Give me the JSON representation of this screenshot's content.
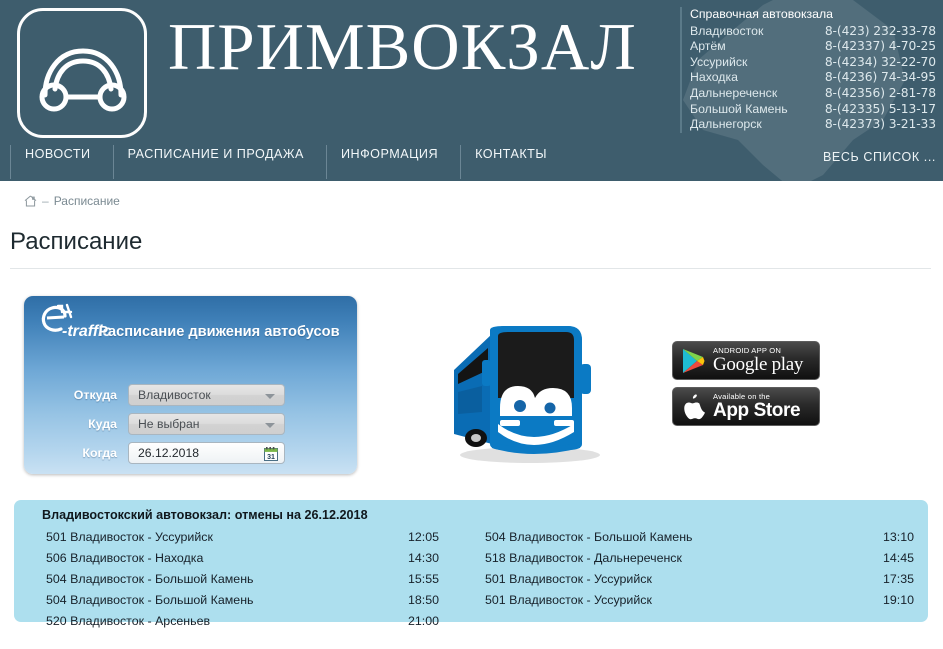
{
  "header": {
    "brand": "ПРИМВОКЗАЛ",
    "logo_icon": "bus-front-icon",
    "map_icon": "region-map-silhouette",
    "nav": [
      {
        "label": "НОВОСТИ",
        "name": "nav-news"
      },
      {
        "label": "РАСПИСАНИЕ И ПРОДАЖА",
        "name": "nav-schedule-sales"
      },
      {
        "label": "ИНФОРМАЦИЯ",
        "name": "nav-information"
      },
      {
        "label": "КОНТАКТЫ",
        "name": "nav-contacts"
      }
    ],
    "info": {
      "title": "Справочная автовокзала",
      "rows": [
        {
          "city": "Владивосток",
          "phone": "8-(423) 232-33-78"
        },
        {
          "city": "Артём",
          "phone": "8-(42337) 4-70-25"
        },
        {
          "city": "Уссурийск",
          "phone": "8-(4234) 32-22-70"
        },
        {
          "city": "Находка",
          "phone": "8-(4236) 74-34-95"
        },
        {
          "city": "Дальнереченск",
          "phone": "8-(42356) 2-81-78"
        },
        {
          "city": "Большой Камень",
          "phone": "8-(42335) 5-13-17"
        },
        {
          "city": "Дальнегорск",
          "phone": "8-(42373) 3-21-33"
        }
      ],
      "all_list_label": "ВЕСЬ СПИСОК ..."
    }
  },
  "breadcrumb": {
    "home_icon": "home-icon",
    "separator": "–",
    "current": "Расписание"
  },
  "page": {
    "title": "Расписание"
  },
  "search_form": {
    "logo_text": "-traffic",
    "heading": "Расписание движения автобусов",
    "from": {
      "label": "Откуда",
      "value": "Владивосток"
    },
    "to": {
      "label": "Куда",
      "value": "Не выбран"
    },
    "when": {
      "label": "Когда",
      "value": "26.12.2018",
      "icon": "calendar-icon"
    }
  },
  "illustration": {
    "name": "cartoon-bus-image",
    "body_color": "#0b7ac4",
    "window_color": "#1b1b1b"
  },
  "badges": [
    {
      "name": "google-play-badge",
      "small": "ANDROID APP ON",
      "big": "Google play",
      "icon": "google-play-icon"
    },
    {
      "name": "app-store-badge",
      "small": "Available on the",
      "big": "App Store",
      "icon": "apple-icon"
    }
  ],
  "schedule": {
    "title": "Владивостокский автовокзал: отмены на 26.12.2018",
    "left_column": [
      {
        "route": "501 Владивосток  -  Уссурийск",
        "time": "12:05"
      },
      {
        "route": "506 Владивосток  -  Находка",
        "time": "14:30"
      },
      {
        "route": "504 Владивосток  -  Большой Камень",
        "time": "15:55"
      },
      {
        "route": "504 Владивосток  -  Большой Камень",
        "time": "18:50"
      },
      {
        "route": "520 Владивосток  -  Арсеньев",
        "time": "21:00"
      }
    ],
    "right_column": [
      {
        "route": "504 Владивосток  -  Большой Камень",
        "time": "13:10"
      },
      {
        "route": "518 Владивосток  -  Дальнереченск",
        "time": "14:45"
      },
      {
        "route": "501 Владивосток  -  Уссурийск",
        "time": "17:35"
      },
      {
        "route": "501 Владивосток  -  Уссурийск",
        "time": "19:10"
      }
    ]
  },
  "colors": {
    "header_bg": "#3e5d6d",
    "panel_blue_top": "#2f6ea6",
    "panel_blue_bottom": "#c9e1f3",
    "schedule_bg": "#addfee",
    "title_text": "#1e2a30"
  }
}
